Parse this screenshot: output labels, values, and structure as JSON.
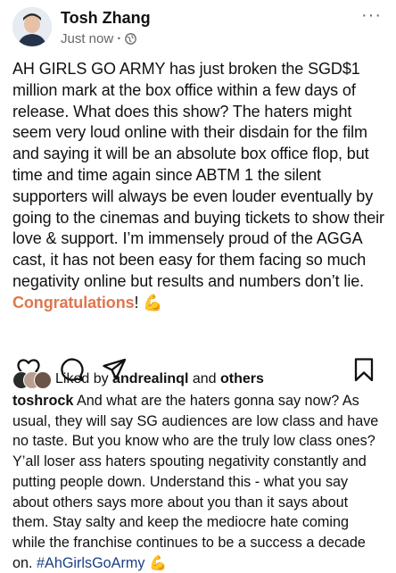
{
  "post": {
    "author": "Tosh Zhang",
    "time": "Just now",
    "separator": "·",
    "more": "···",
    "body_main": "AH GIRLS GO ARMY has just broken the SGD$1 million mark at the box office within a few days of release. What does this show? The haters might seem very loud online with their disdain for the film and saying it will be an absolute box office flop, but time and time again since ABTM 1 the silent supporters will always be even louder eventually by going to the cinemas and buying tickets to show their love & support. I’m immensely proud of the AGGA cast, it has not been easy for them facing so much negativity online but results and numbers don’t lie. ",
    "body_highlight": "Congratulations",
    "body_end": "! ",
    "emoji": "💪"
  },
  "instagram": {
    "likes_prefix": "Liked by ",
    "likes_user": "andrealinql",
    "likes_middle": " and ",
    "likes_others": "others",
    "caption_user": "toshrock",
    "caption_text": " And what are the haters gonna say now? As usual, they will say SG audiences are low class and have no taste. But you know who are the truly low class ones? Y’all loser ass haters spouting negativity constantly and putting people down. Understand this - what you say about others says more about you than it says about them. Stay salty and keep the mediocre hate coming while the franchise continues to be a success a decade on. ",
    "hashtag": "#AhGirlsGoArmy",
    "emoji": "💪",
    "icons": [
      "heart-icon",
      "comment-icon",
      "share-icon",
      "bookmark-icon"
    ]
  }
}
